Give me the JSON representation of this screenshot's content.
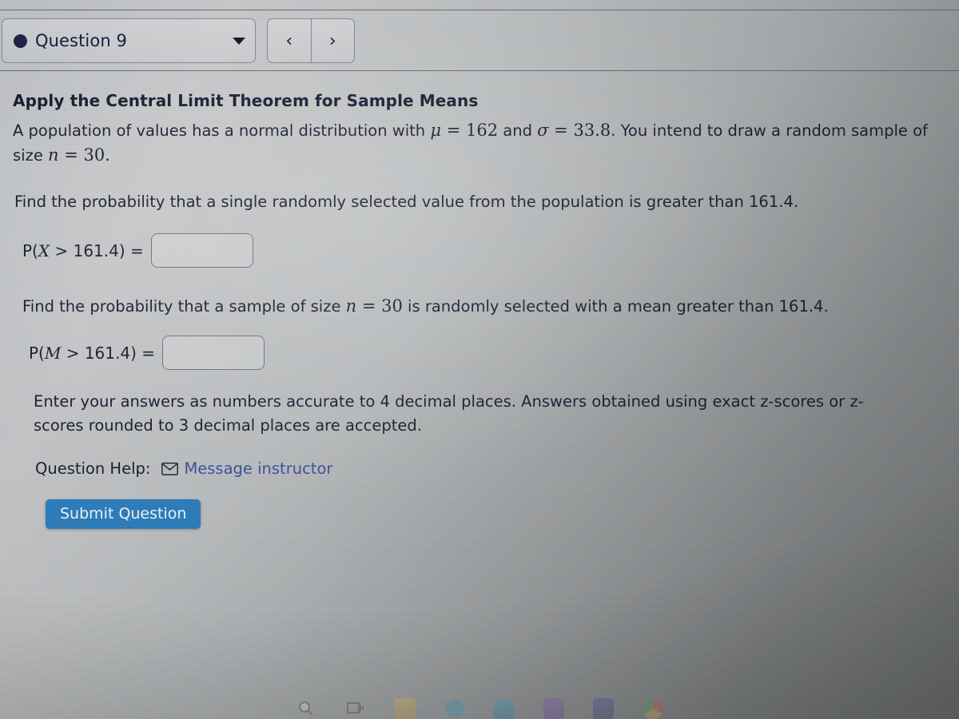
{
  "header": {
    "question_selector": {
      "label": "Question 9",
      "status_icon": "filled-circle",
      "caret_icon": "caret-down-icon"
    },
    "nav": {
      "prev_label": "‹",
      "next_label": "›"
    }
  },
  "question": {
    "title": "Apply the Central Limit Theorem for Sample Means",
    "setup": {
      "part1": "A population of values has a normal distribution with ",
      "mu_symbol": "μ",
      "eq1": " = ",
      "mu_value": "162",
      "part2": " and ",
      "sigma_symbol": "σ",
      "eq2": " = ",
      "sigma_value": "33.8",
      "part3": ". You intend to draw a random sample of size ",
      "n_symbol": "n",
      "eq3": " = ",
      "n_value": "30",
      "part4": "."
    },
    "prompt_single": "Find the probability that a single randomly selected value from the population is greater than 161.4.",
    "prompt_sample_a": "Find the probability that a sample of size ",
    "prompt_sample_n_symbol": "n",
    "prompt_sample_eq": " = ",
    "prompt_sample_n_value": "30",
    "prompt_sample_b": " is randomly selected with a mean greater than 161.4.",
    "answers": [
      {
        "label_prefix": "P(",
        "label_var": "X",
        "label_suffix": " > 161.4) =",
        "value": "",
        "placeholder": ""
      },
      {
        "label_prefix": "P(",
        "label_var": "M",
        "label_suffix": " > 161.4) =",
        "value": "",
        "placeholder": ""
      }
    ],
    "note": "Enter your answers as numbers accurate to 4 decimal places. Answers obtained using exact z-scores or z-scores rounded to 3 decimal places are accepted.",
    "help_label": "Question Help:",
    "message_instructor": "Message instructor",
    "message_icon": "envelope-icon",
    "submit_label": "Submit Question"
  },
  "colors": {
    "submit_button": "#2a7cbb",
    "link": "#3b4f9e",
    "status_dot": "#1d2046",
    "text": "#1a1c30"
  },
  "taskbar": {
    "icons": [
      "search-icon",
      "task-view-icon",
      "file-explorer-icon",
      "edge-browser-icon",
      "onedrive-icon",
      "purple-app-icon",
      "microsoft-store-icon",
      "chrome-browser-icon"
    ]
  }
}
